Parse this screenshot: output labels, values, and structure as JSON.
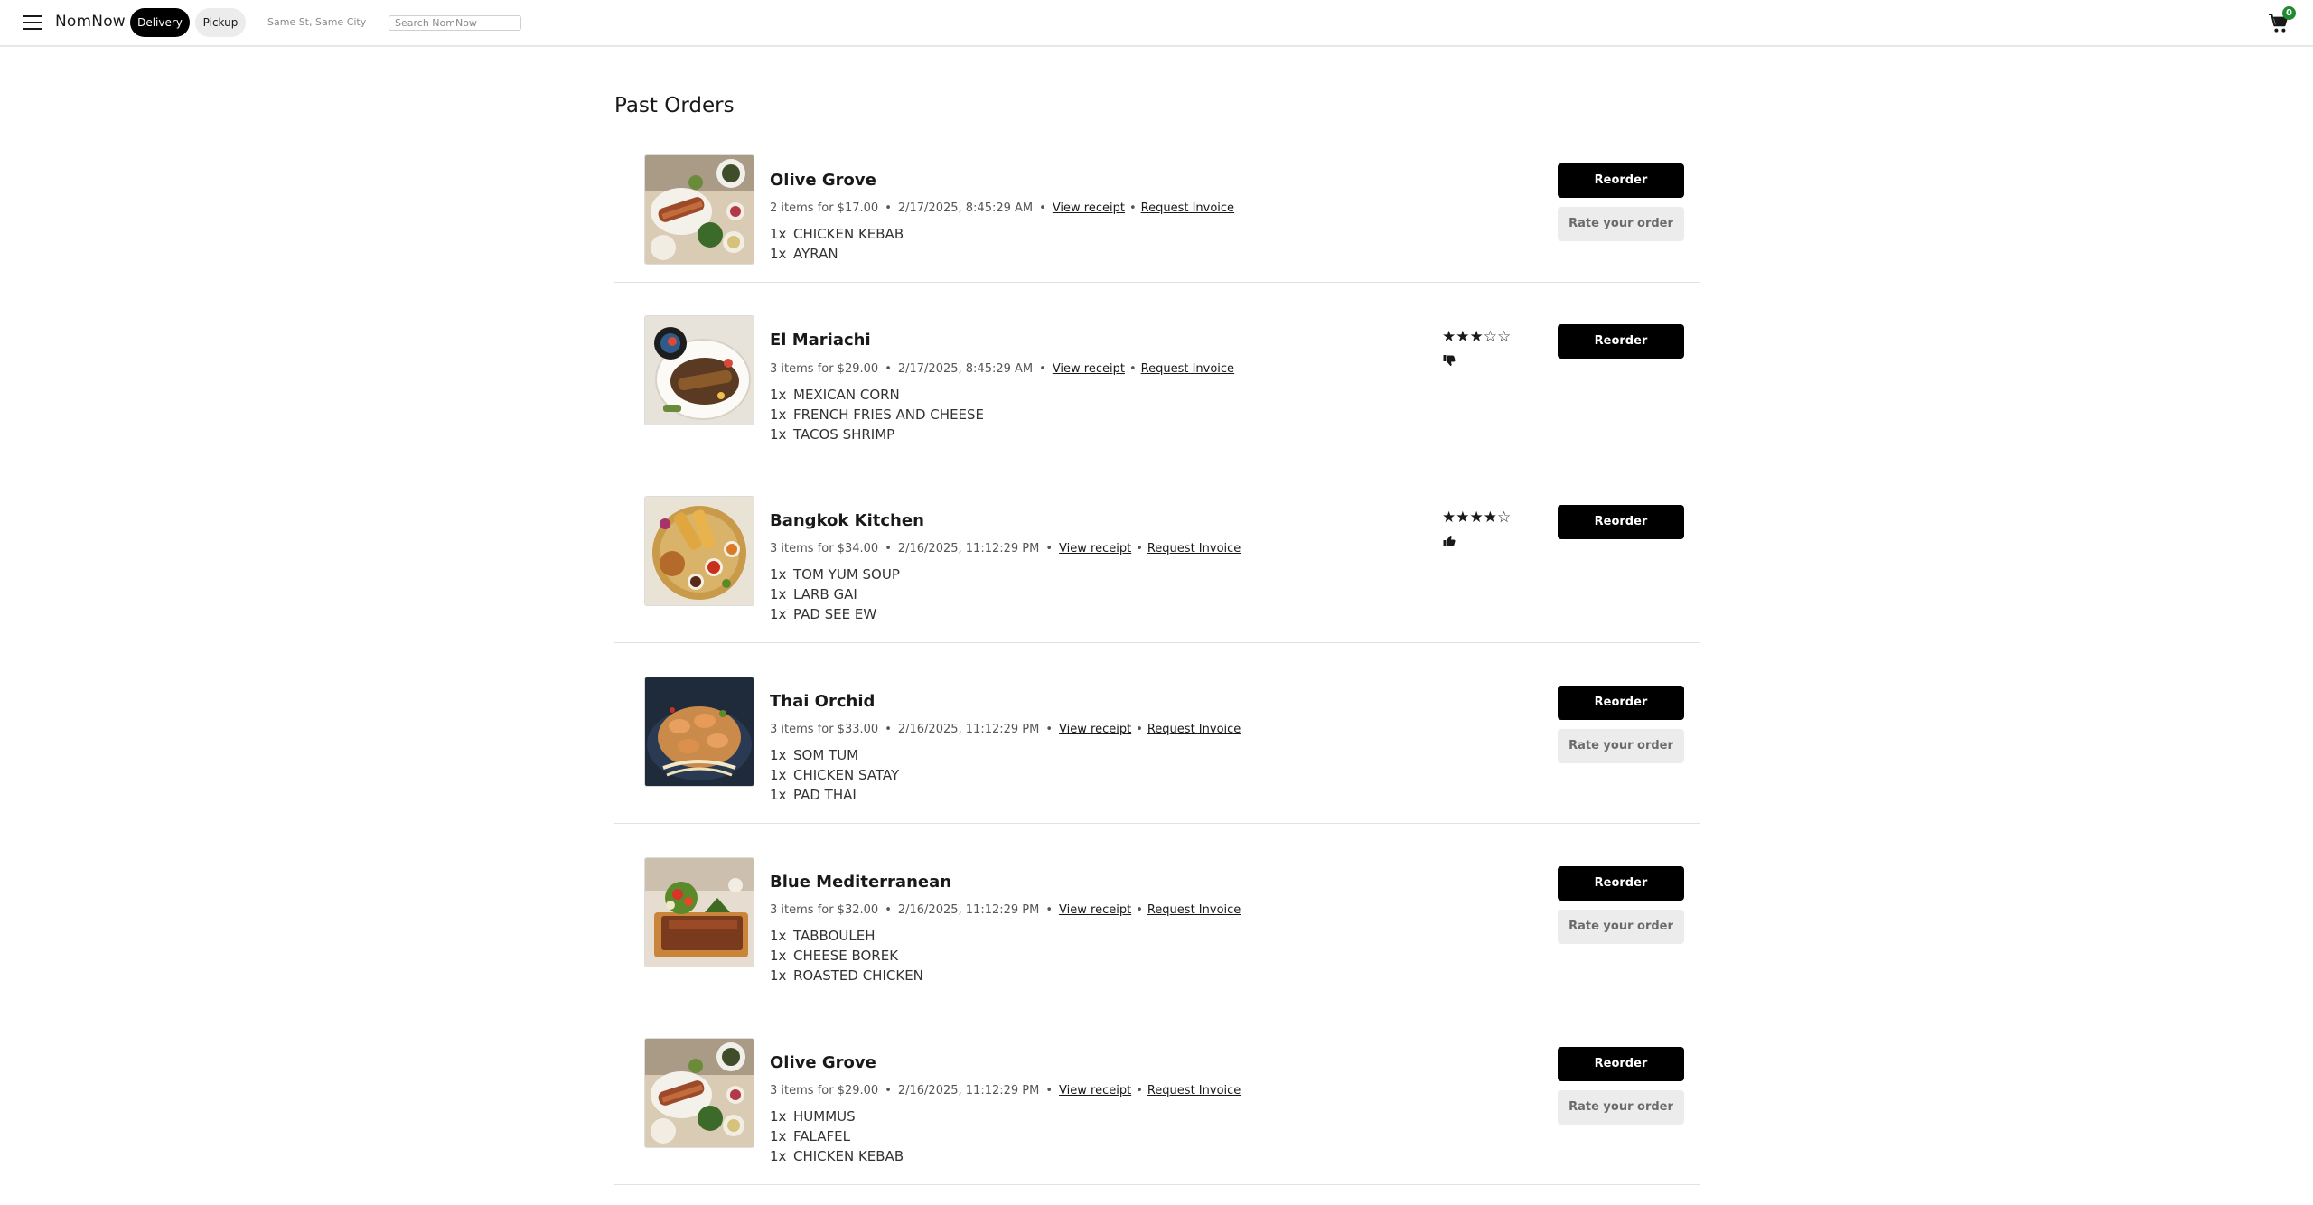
{
  "header": {
    "brand": "NomNow",
    "delivery_label": "Delivery",
    "pickup_label": "Pickup",
    "address": "Same St, Same City",
    "search_placeholder": "Search NomNow",
    "cart_count": "0"
  },
  "main": {
    "title": "Past Orders",
    "view_receipt_label": "View receipt",
    "request_invoice_label": "Request Invoice",
    "reorder_label": "Reorder",
    "rate_label": "Rate your order",
    "orders": [
      {
        "restaurant": "Olive Grove",
        "summary": "2 items for $17.00",
        "datetime": "2/17/2025, 8:45:29 AM",
        "items": [
          {
            "qty": "1x",
            "name": "CHICKEN KEBAB"
          },
          {
            "qty": "1x",
            "name": "AYRAN"
          }
        ],
        "rated": false
      },
      {
        "restaurant": "El Mariachi",
        "summary": "3 items for $29.00",
        "datetime": "2/17/2025, 8:45:29 AM",
        "items": [
          {
            "qty": "1x",
            "name": "MEXICAN CORN"
          },
          {
            "qty": "1x",
            "name": "FRENCH FRIES AND CHEESE"
          },
          {
            "qty": "1x",
            "name": "TACOS SHRIMP"
          }
        ],
        "rated": true,
        "rating_stars": 3,
        "rating_text": "★★★☆☆",
        "thumb": "thumbs-down-icon"
      },
      {
        "restaurant": "Bangkok Kitchen",
        "summary": "3 items for $34.00",
        "datetime": "2/16/2025, 11:12:29 PM",
        "items": [
          {
            "qty": "1x",
            "name": "TOM YUM SOUP"
          },
          {
            "qty": "1x",
            "name": "LARB GAI"
          },
          {
            "qty": "1x",
            "name": "PAD SEE EW"
          }
        ],
        "rated": true,
        "rating_stars": 4,
        "rating_text": "★★★★☆",
        "thumb": "thumbs-up-icon"
      },
      {
        "restaurant": "Thai Orchid",
        "summary": "3 items for $33.00",
        "datetime": "2/16/2025, 11:12:29 PM",
        "items": [
          {
            "qty": "1x",
            "name": "SOM TUM"
          },
          {
            "qty": "1x",
            "name": "CHICKEN SATAY"
          },
          {
            "qty": "1x",
            "name": "PAD THAI"
          }
        ],
        "rated": false
      },
      {
        "restaurant": "Blue Mediterranean",
        "summary": "3 items for $32.00",
        "datetime": "2/16/2025, 11:12:29 PM",
        "items": [
          {
            "qty": "1x",
            "name": "TABBOULEH"
          },
          {
            "qty": "1x",
            "name": "CHEESE BOREK"
          },
          {
            "qty": "1x",
            "name": "ROASTED CHICKEN"
          }
        ],
        "rated": false
      },
      {
        "restaurant": "Olive Grove",
        "summary": "3 items for $29.00",
        "datetime": "2/16/2025, 11:12:29 PM",
        "items": [
          {
            "qty": "1x",
            "name": "HUMMUS"
          },
          {
            "qty": "1x",
            "name": "FALAFEL"
          },
          {
            "qty": "1x",
            "name": "CHICKEN KEBAB"
          }
        ],
        "rated": false
      }
    ]
  }
}
